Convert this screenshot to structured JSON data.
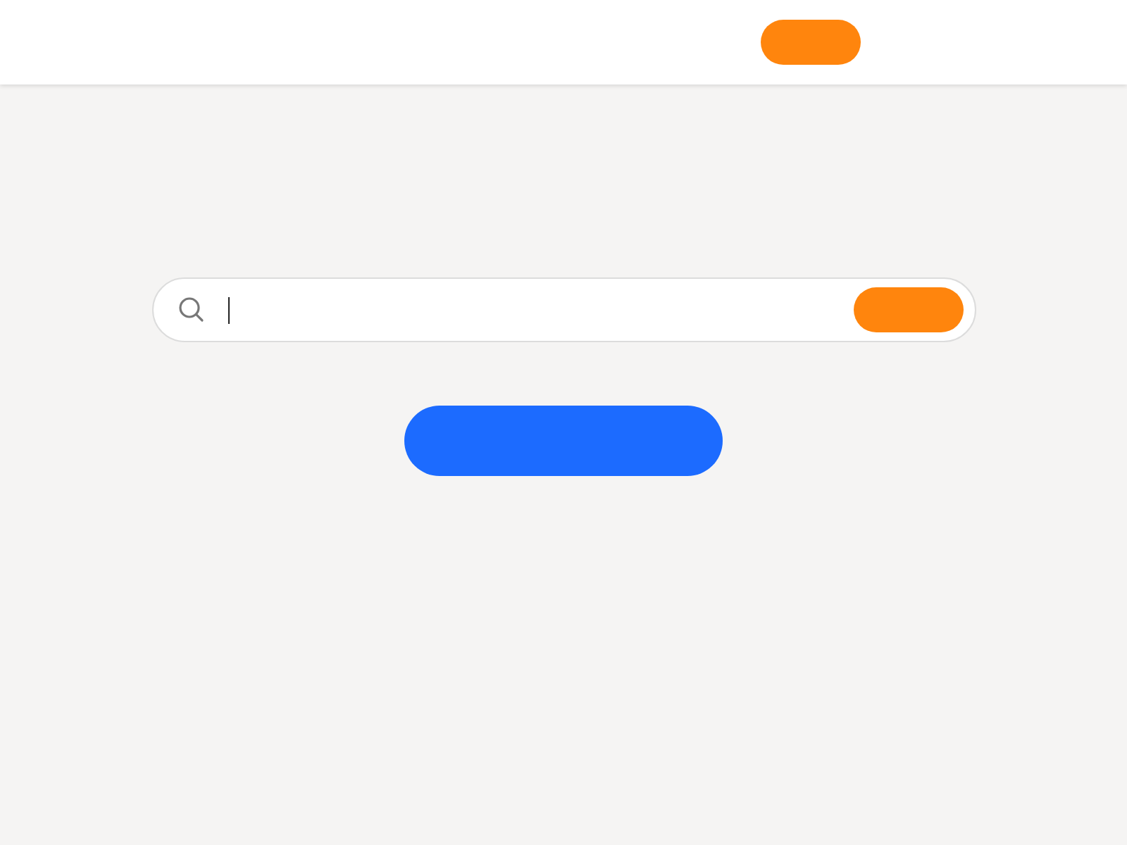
{
  "search": {
    "focused": true
  }
}
